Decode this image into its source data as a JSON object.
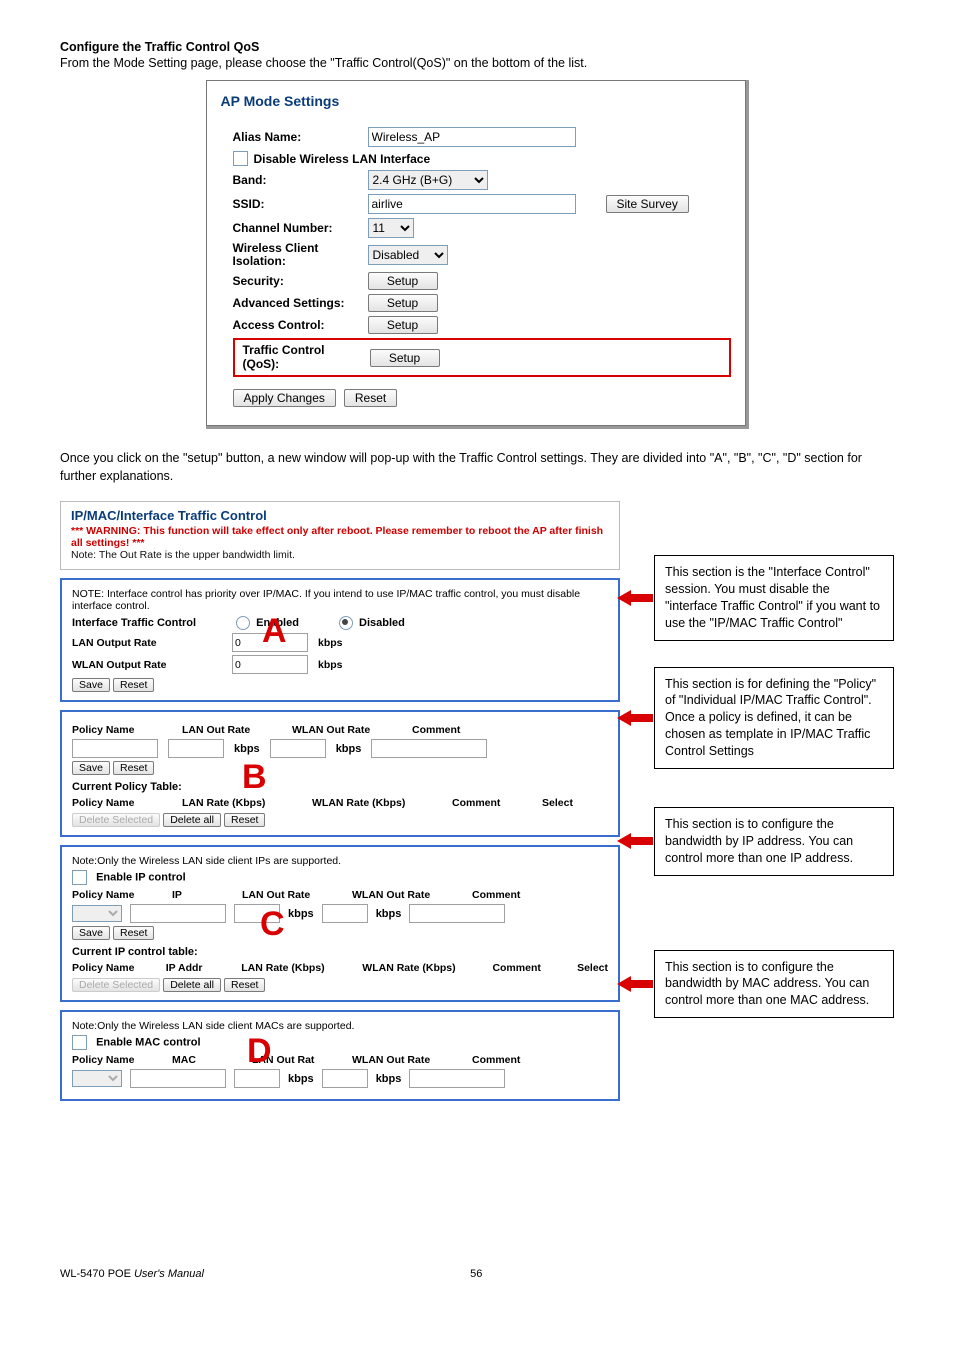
{
  "heading": "Configure the Traffic Control QoS",
  "intro": "From the Mode Setting page, please choose the \"Traffic Control(QoS)\" on the bottom of the list.",
  "ap": {
    "title": "AP Mode Settings",
    "alias_lbl": "Alias Name:",
    "alias_val": "Wireless_AP",
    "disable_wlan": "Disable Wireless LAN Interface",
    "band_lbl": "Band:",
    "band_val": "2.4 GHz (B+G)",
    "ssid_lbl": "SSID:",
    "ssid_val": "airlive",
    "site_survey": "Site Survey",
    "chan_lbl": "Channel Number:",
    "chan_val": "11",
    "wci_lbl1": "Wireless Client",
    "wci_lbl2": "Isolation:",
    "wci_val": "Disabled",
    "sec_lbl": "Security:",
    "adv_lbl": "Advanced Settings:",
    "acc_lbl": "Access Control:",
    "tc_lbl1": "Traffic Control",
    "tc_lbl2": "(QoS):",
    "setup": "Setup",
    "apply": "Apply Changes",
    "reset": "Reset"
  },
  "desc2": "Once you click on the \"setup\" button, a new window will pop-up with the Traffic Control settings.    They are divided into \"A\", \"B\", \"C\", \"D\" section for further explanations.",
  "tc": {
    "title": "IP/MAC/Interface Traffic Control",
    "warn": "*** WARNING: This function will take effect only after reboot. Please remember to reboot the AP after finish all settings! ***",
    "note1": "Note: The Out Rate is the upper bandwidth limit.",
    "A": {
      "note": "NOTE: Interface control has priority over IP/MAC. If you intend to use IP/MAC traffic control, you must disable interface control.",
      "itc": "Interface Traffic Control",
      "enabled": "Enabled",
      "disabled": "Disabled",
      "lan": "LAN Output Rate",
      "wlan": "WLAN Output Rate",
      "zero": "0",
      "kbps": "kbps",
      "save": "Save",
      "reset": "Reset"
    },
    "B": {
      "h_pn": "Policy Name",
      "h_lan": "LAN Out Rate",
      "h_wlan": "WLAN Out Rate",
      "h_cmt": "Comment",
      "kbps": "kbps",
      "save": "Save",
      "reset": "Reset",
      "cpt": "Current Policy Table:",
      "h_lanr": "LAN Rate (Kbps)",
      "h_wlanr": "WLAN Rate (Kbps)",
      "h_sel": "Select",
      "delsel": "Delete Selected",
      "delall": "Delete all"
    },
    "C": {
      "note": "Note:Only the Wireless LAN side client IPs are supported.",
      "enable": "Enable IP control",
      "h_pn": "Policy Name",
      "h_ip": "IP",
      "h_lan": "LAN Out Rate",
      "h_wlan": "WLAN Out Rate",
      "h_cmt": "Comment",
      "kbps": "kbps",
      "save": "Save",
      "reset": "Reset",
      "cpt": "Current IP control table:",
      "h_ipa": "IP Addr",
      "h_lanr": "LAN Rate (Kbps)",
      "h_wlanr": "WLAN Rate (Kbps)",
      "h_sel": "Select",
      "delsel": "Delete Selected",
      "delall": "Delete all"
    },
    "D": {
      "note": "Note:Only the Wireless LAN side client MACs are supported.",
      "enable": "Enable MAC control",
      "h_pn": "Policy Name",
      "h_mac": "MAC",
      "h_lan": "LAN Out Rat",
      "h_wlan": "WLAN Out Rate",
      "h_cmt": "Comment",
      "kbps": "kbps"
    }
  },
  "callouts": {
    "A": "This section is the \"Interface Control\" session.    You must disable the \"interface Traffic Control\" if you want to use the \"IP/MAC Traffic Control\"",
    "B": "This section is for defining the \"Policy\" of \"Individual IP/MAC Traffic Control\".    Once a policy is defined, it can be chosen as template in IP/MAC Traffic Control Settings",
    "C": "This section is to configure the bandwidth by IP address.    You can control more than one IP address.",
    "D": "This section is to configure the bandwidth by MAC address. You can control more than one MAC address."
  },
  "footer_left": "WL-5470 POE ",
  "footer_left_i": "User's Manual",
  "page_no": "56"
}
